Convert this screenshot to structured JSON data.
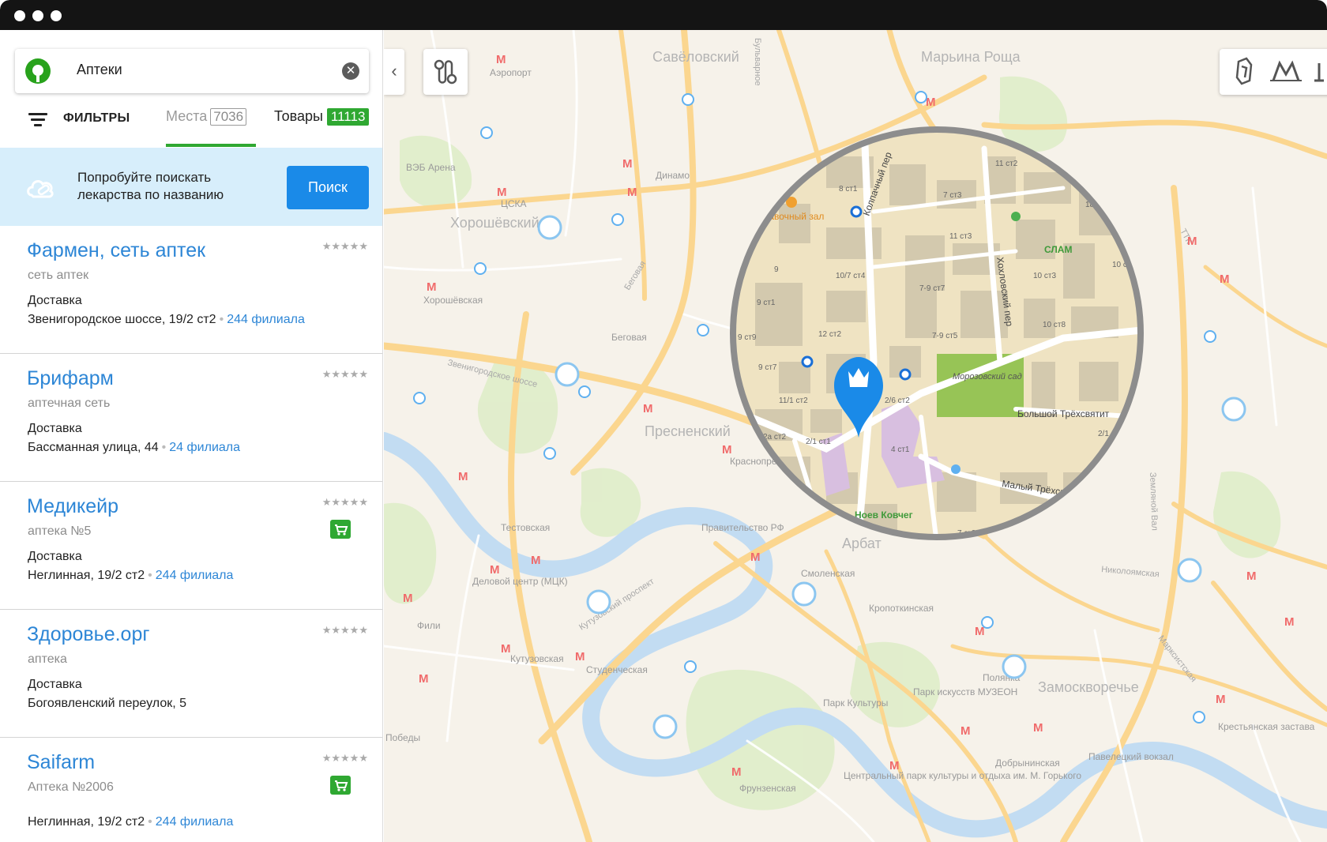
{
  "search": {
    "query": "Аптеки",
    "clear_symbol": "✕"
  },
  "filters": {
    "label": "ФИЛЬТРЫ",
    "tab_places_label": "Места",
    "tab_places_count": "7036",
    "tab_goods_label": "Товары",
    "tab_goods_count": "11113"
  },
  "promo": {
    "line1": "Попробуйте поискать",
    "line2": "лекарства по названию",
    "button": "Поиск"
  },
  "results": [
    {
      "name": "Фармен, сеть аптек",
      "subtitle": "сеть аптек",
      "delivery": "Доставка",
      "address": "Звенигородское шоссе, 19/2 ст2",
      "branches": "244 филиала",
      "stars": "★★★★★",
      "cart": false
    },
    {
      "name": "Брифарм",
      "subtitle": "аптечная сеть",
      "delivery": "Доставка",
      "address": "Бассманная улица, 44",
      "branches": "24 филиала",
      "stars": "★★★★★",
      "cart": false
    },
    {
      "name": "Медикейр",
      "subtitle": "аптека №5",
      "delivery": "Доставка",
      "address": "Неглинная, 19/2 ст2",
      "branches": "244 филиала",
      "stars": "★★★★★",
      "cart": true
    },
    {
      "name": "Здоровье.орг",
      "subtitle": "аптека",
      "delivery": "Доставка",
      "address": "Богоявленский переулок, 5",
      "branches": "",
      "stars": "★★★★★",
      "cart": false
    },
    {
      "name": "Saifarm",
      "subtitle": "Аптека №2006",
      "delivery": "",
      "address": "Неглинная, 19/2 ст2",
      "branches": "244 филиала",
      "stars": "★★★★★",
      "cart": true
    }
  ],
  "map": {
    "collapse_symbol": "‹",
    "districts": [
      "Савёловский",
      "Марьина Роща",
      "Хорошёвский",
      "Пресненский",
      "Арбат",
      "Замоскворечье"
    ],
    "stations": [
      "Аэропорт",
      "Динамо",
      "ЦСКА",
      "Хорошёвская",
      "Беговая",
      "Тестовская",
      "Деловой центр (МЦК)",
      "Фили",
      "Кутузовская",
      "Студенческая",
      "Краснопресненская",
      "Смоленская",
      "Кропоткинская",
      "Фрунзенская",
      "Полянка",
      "Добрынинская",
      "Павелецкий вокзал",
      "Парк Культуры",
      "Парк искусств МУЗЕОН",
      "Центральный парк культуры и отдыха им. М. Горького",
      "Правительство РФ",
      "ВЭБ Арена",
      "Победы",
      "Крестьянская застава"
    ],
    "streets": [
      "Звенигородское шоссе",
      "Кутузовский проспект",
      "ТТК",
      "Бульварное",
      "Земляной Вал",
      "Николоямская",
      "Марксистская",
      "Беговая"
    ],
    "zoom_labels": [
      "Колпачный пер",
      "Хохловский пер",
      "Большой Трёхсвятит",
      "Малый Трёхсв",
      "Морозовский сад",
      "СЛАМ",
      "Ноев Ковчег",
      "тавочный зал",
      "11 ст2",
      "8 ст1",
      "7 ст3",
      "18 ст",
      "10 ст",
      "11 ст3",
      "10/7 ст4",
      "7-9 ст7",
      "10 ст3",
      "9",
      "9 ст1",
      "12 ст2",
      "7-9 ст5",
      "10 ст8",
      "9 ст9",
      "9 ст7",
      "11/1 ст2",
      "2/6 ст2",
      "2/1 ст1",
      "2а ст2",
      "4 ст1",
      "2/1",
      "3а ст2",
      "7 ст3"
    ],
    "colors": {
      "accent_green": "#2fa832",
      "link_blue": "#2d86d6",
      "pin_blue": "#1a8ae8",
      "park_green": "#8cc34a",
      "road_yellow": "#fcd48a"
    }
  }
}
